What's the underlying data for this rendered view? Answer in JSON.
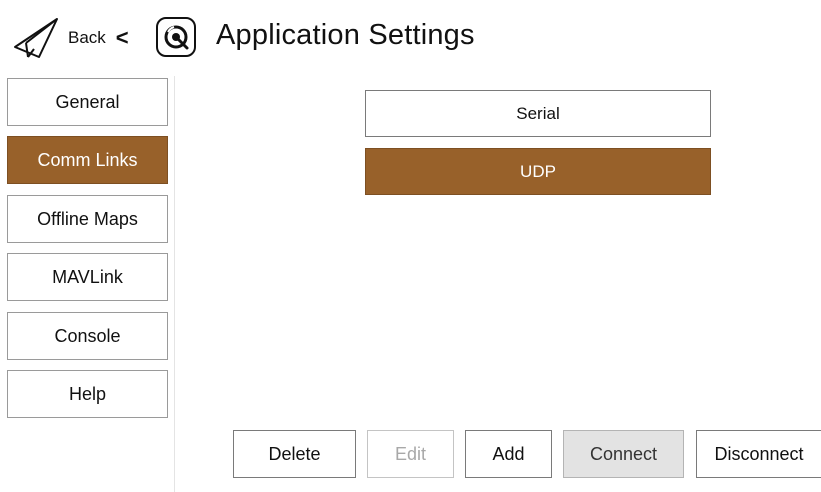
{
  "header": {
    "back_label": "Back",
    "back_chevron": "<",
    "title": "Application Settings",
    "icons": {
      "back": "paper-plane-icon",
      "logo": "qgroundcontrol-logo-icon"
    }
  },
  "sidebar": {
    "items": [
      {
        "label": "General",
        "active": false
      },
      {
        "label": "Comm Links",
        "active": true
      },
      {
        "label": "Offline Maps",
        "active": false
      },
      {
        "label": "MAVLink",
        "active": false
      },
      {
        "label": "Console",
        "active": false
      },
      {
        "label": "Help",
        "active": false
      }
    ]
  },
  "links": {
    "items": [
      {
        "label": "Serial",
        "selected": false
      },
      {
        "label": "UDP",
        "selected": true
      }
    ]
  },
  "actions": {
    "delete": {
      "label": "Delete",
      "enabled": true
    },
    "edit": {
      "label": "Edit",
      "enabled": false
    },
    "add": {
      "label": "Add",
      "enabled": true
    },
    "connect": {
      "label": "Connect",
      "enabled": true
    },
    "disconnect": {
      "label": "Disconnect",
      "enabled": true
    }
  },
  "colors": {
    "accent": "#98612a",
    "accent_text": "#ffffff",
    "connect_bg": "#e3e3e3",
    "disabled_text": "#a8a8a8"
  }
}
